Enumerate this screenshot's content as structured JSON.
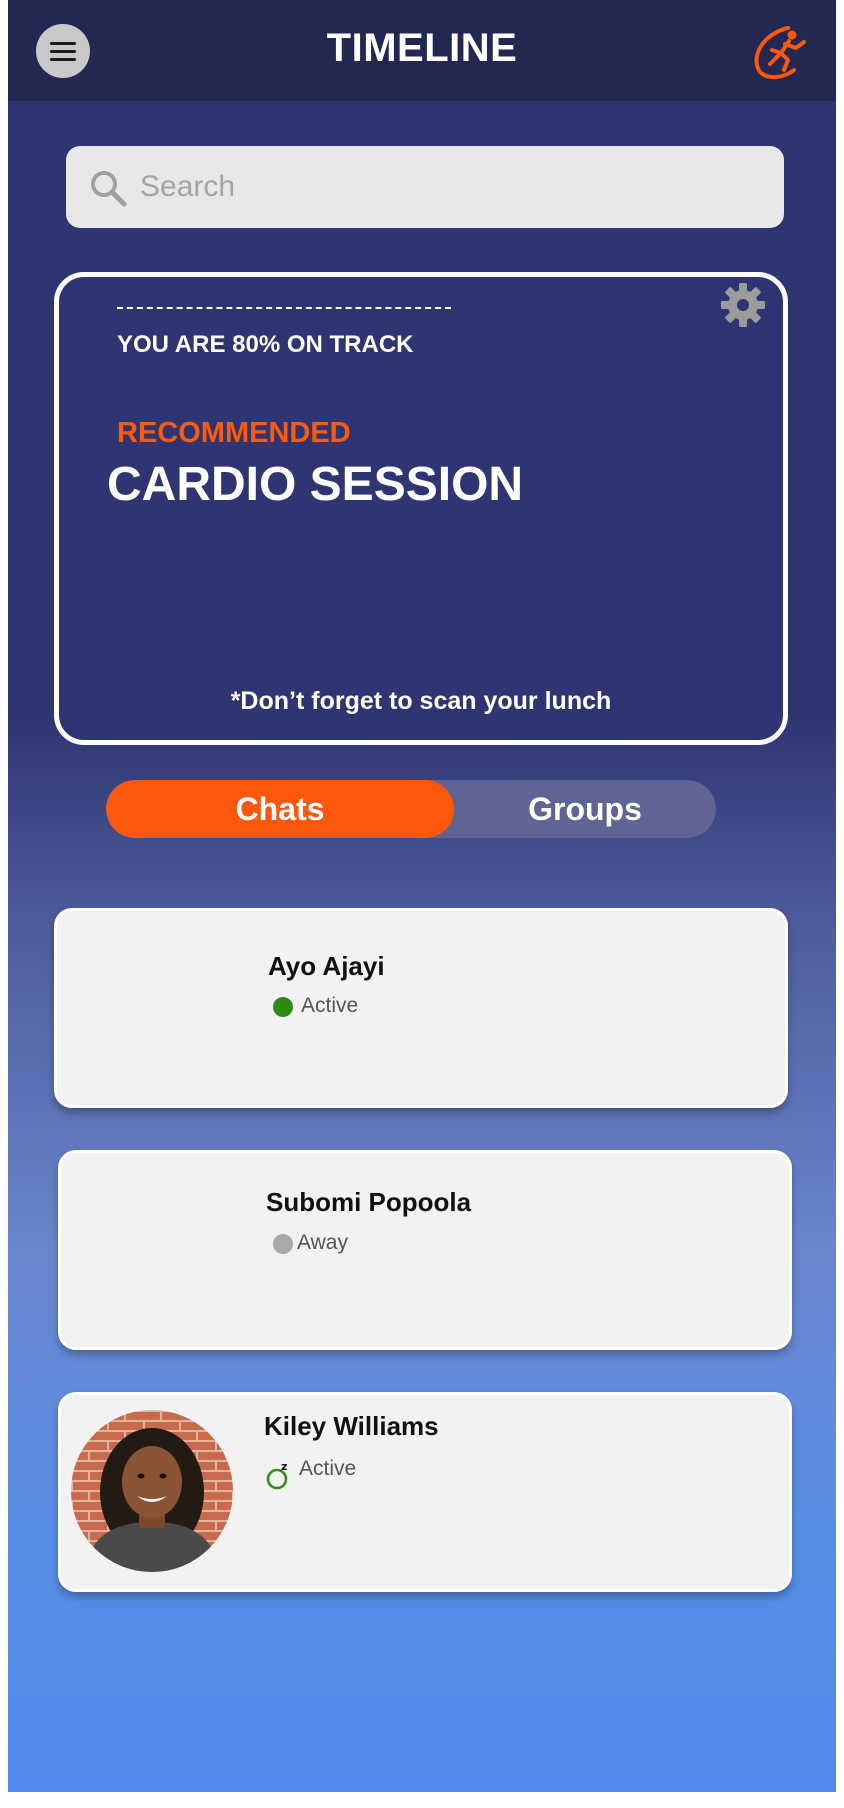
{
  "header": {
    "title": "TIMELINE"
  },
  "search": {
    "placeholder": "Search",
    "value": ""
  },
  "track_card": {
    "progress_text": "YOU ARE 80% ON TRACK",
    "progress_percent": 80,
    "recommended_label": "RECOMMENDED",
    "session_title": "CARDIO SESSION",
    "reminder": "*Don’t forget to scan your lunch"
  },
  "tabs": [
    {
      "label": "Chats",
      "selected": true
    },
    {
      "label": "Groups",
      "selected": false
    }
  ],
  "chats": [
    {
      "name": "Ayo Ajayi",
      "status": "Active",
      "status_color": "#2e8b12"
    },
    {
      "name": "Subomi Popoola",
      "status": "Away",
      "status_color": "#a9a9a9"
    },
    {
      "name": "Kiley Williams",
      "status": "Active",
      "status_color": "#2e8b12"
    }
  ],
  "colors": {
    "accent": "#ff570c",
    "header_bg": "#222852",
    "card_bg": "#2f3572"
  }
}
